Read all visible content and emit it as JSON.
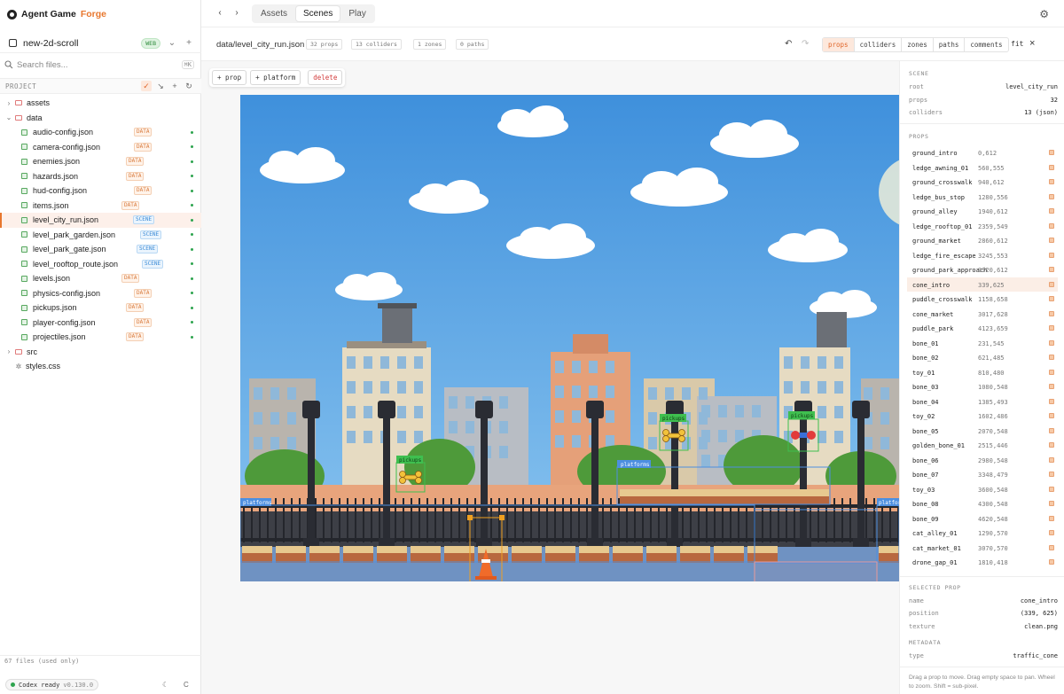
{
  "app": {
    "name": "Agent Game",
    "name_accent": "Forge"
  },
  "project": {
    "name": "new-2d-scroll",
    "badge": "WEB"
  },
  "search": {
    "placeholder": "Search files...",
    "shortcut": "⌘K"
  },
  "tree_header": "PROJECT",
  "tree": [
    {
      "type": "folder",
      "name": "assets",
      "open": false
    },
    {
      "type": "folder",
      "name": "data",
      "open": true
    },
    {
      "type": "file",
      "name": "audio-config.json",
      "tag": "DATA"
    },
    {
      "type": "file",
      "name": "camera-config.json",
      "tag": "DATA"
    },
    {
      "type": "file",
      "name": "enemies.json",
      "tag": "DATA"
    },
    {
      "type": "file",
      "name": "hazards.json",
      "tag": "DATA"
    },
    {
      "type": "file",
      "name": "hud-config.json",
      "tag": "DATA"
    },
    {
      "type": "file",
      "name": "items.json",
      "tag": "DATA"
    },
    {
      "type": "file",
      "name": "level_city_run.json",
      "tag": "SCENE",
      "selected": true
    },
    {
      "type": "file",
      "name": "level_park_garden.json",
      "tag": "SCENE"
    },
    {
      "type": "file",
      "name": "level_park_gate.json",
      "tag": "SCENE"
    },
    {
      "type": "file",
      "name": "level_rooftop_route.json",
      "tag": "SCENE"
    },
    {
      "type": "file",
      "name": "levels.json",
      "tag": "DATA"
    },
    {
      "type": "file",
      "name": "physics-config.json",
      "tag": "DATA"
    },
    {
      "type": "file",
      "name": "pickups.json",
      "tag": "DATA"
    },
    {
      "type": "file",
      "name": "player-config.json",
      "tag": "DATA"
    },
    {
      "type": "file",
      "name": "projectiles.json",
      "tag": "DATA"
    },
    {
      "type": "folder",
      "name": "src",
      "open": false
    },
    {
      "type": "css",
      "name": "styles.css"
    }
  ],
  "files_count": "67 files (used only)",
  "status": {
    "label": "Codex ready",
    "version": "v0.130.0"
  },
  "nav": {
    "tabs": [
      "Assets",
      "Scenes",
      "Play"
    ],
    "active": "Scenes"
  },
  "editor": {
    "path": "data/level_city_run.json",
    "stats": [
      "32 props",
      "13 colliders",
      "1 zones",
      "0 paths"
    ],
    "filters": [
      "props",
      "colliders",
      "zones",
      "paths",
      "comments"
    ],
    "active_filter": "props",
    "fit_label": "fit",
    "close_label": "×"
  },
  "toolbar": {
    "add_prop": "+ prop",
    "add_platform": "+ platform",
    "delete": "delete"
  },
  "overlays": {
    "pickups": "pickups",
    "platforms": "platforms"
  },
  "inspector": {
    "scene_header": "SCENE",
    "scene": [
      {
        "k": "root",
        "v": "level_city_run"
      },
      {
        "k": "props",
        "v": "32"
      },
      {
        "k": "colliders",
        "v": "13 (json)"
      }
    ],
    "props_header": "PROPS",
    "props": [
      {
        "name": "ground_intro",
        "coords": "0,612"
      },
      {
        "name": "ledge_awning_01",
        "coords": "560,555"
      },
      {
        "name": "ground_crosswalk",
        "coords": "940,612"
      },
      {
        "name": "ledge_bus_stop",
        "coords": "1280,556"
      },
      {
        "name": "ground_alley",
        "coords": "1940,612"
      },
      {
        "name": "ledge_rooftop_01",
        "coords": "2359,549"
      },
      {
        "name": "ground_market",
        "coords": "2860,612"
      },
      {
        "name": "ledge_fire_escape",
        "coords": "3245,553"
      },
      {
        "name": "ground_park_approach",
        "coords": "3920,612"
      },
      {
        "name": "cone_intro",
        "coords": "339,625",
        "selected": true
      },
      {
        "name": "puddle_crosswalk",
        "coords": "1158,658"
      },
      {
        "name": "cone_market",
        "coords": "3017,628"
      },
      {
        "name": "puddle_park",
        "coords": "4123,659"
      },
      {
        "name": "bone_01",
        "coords": "231,545"
      },
      {
        "name": "bone_02",
        "coords": "621,485"
      },
      {
        "name": "toy_01",
        "coords": "810,480"
      },
      {
        "name": "bone_03",
        "coords": "1080,548"
      },
      {
        "name": "bone_04",
        "coords": "1385,493"
      },
      {
        "name": "toy_02",
        "coords": "1602,486"
      },
      {
        "name": "bone_05",
        "coords": "2070,548"
      },
      {
        "name": "golden_bone_01",
        "coords": "2515,446"
      },
      {
        "name": "bone_06",
        "coords": "2980,548"
      },
      {
        "name": "bone_07",
        "coords": "3348,479"
      },
      {
        "name": "toy_03",
        "coords": "3600,548"
      },
      {
        "name": "bone_08",
        "coords": "4300,548"
      },
      {
        "name": "bone_09",
        "coords": "4620,548"
      },
      {
        "name": "cat_alley_01",
        "coords": "1290,570"
      },
      {
        "name": "cat_market_01",
        "coords": "3070,570"
      },
      {
        "name": "drone_gap_01",
        "coords": "1810,418"
      }
    ],
    "selected_header": "SELECTED PROP",
    "selected": [
      {
        "k": "name",
        "v": "cone_intro"
      },
      {
        "k": "position",
        "v": "(339, 625)"
      },
      {
        "k": "texture",
        "v": "clean.png"
      }
    ],
    "metadata_header": "METADATA",
    "metadata": [
      {
        "k": "type",
        "v": "traffic_cone"
      }
    ],
    "hint": "Drag a prop to move. Drag empty space to pan. Wheel to zoom. Shift = sub-pixel."
  },
  "colors": {
    "accent": "#e8772e",
    "sky": "#4c9be0",
    "ok": "#2ea44f"
  }
}
